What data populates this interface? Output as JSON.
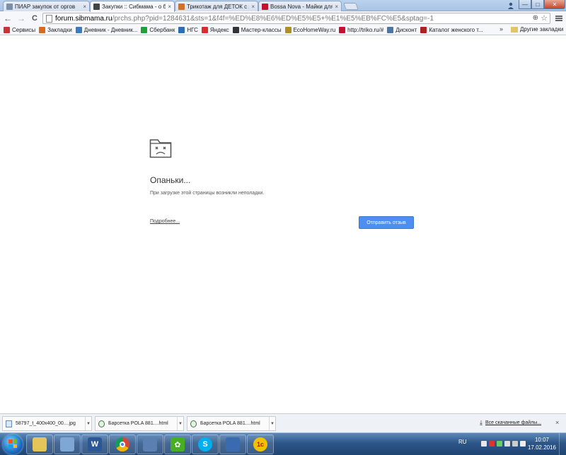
{
  "tabs": [
    {
      "title": "ПИАР закупок от оргов",
      "favicon_color": "#7a8fa8",
      "active": false
    },
    {
      "title": "Закупки :: Сибмама - о б",
      "favicon_color": "#444444",
      "active": true
    },
    {
      "title": "Трикотаж для ДЕТОК с яр",
      "favicon_color": "#c9732d",
      "active": false
    },
    {
      "title": "Bossa Nova - Майки для",
      "favicon_color": "#c8102e",
      "active": false
    }
  ],
  "tab_close_glyph": "×",
  "window_controls": {
    "minimize": "—",
    "maximize": "□",
    "close": "✕"
  },
  "toolbar": {
    "back": "←",
    "forward": "→",
    "reload": "C",
    "url_host": "forum.sibmama.ru",
    "url_path": "/prchs.php?pid=1284631&sts=1&f4f=%ED%E8%E6%ED%E5%E5+%E1%E5%EB%FC%E5&sptag=-1",
    "zoom_glyph": "⊕",
    "star_glyph": "☆"
  },
  "bookmarks": [
    {
      "label": "Сервисы",
      "icon": "grid-icon",
      "color": "#cc3333"
    },
    {
      "label": "Закладки",
      "icon": "pumpkin-icon",
      "color": "#d66b1f"
    },
    {
      "label": "Дневник - Дневник...",
      "icon": "diary-icon",
      "color": "#3b7bbf"
    },
    {
      "label": "Сбербанк",
      "icon": "sberbank-icon",
      "color": "#21a038"
    },
    {
      "label": "НГС",
      "icon": "ngs-icon",
      "color": "#2c6fb5"
    },
    {
      "label": "Яндекс",
      "icon": "yandex-icon",
      "color": "#e02b2b"
    },
    {
      "label": "Мастер-классы",
      "icon": "master-icon",
      "color": "#333333"
    },
    {
      "label": "EcoHomeWay.ru",
      "icon": "eco-icon",
      "color": "#b09020"
    },
    {
      "label": "http://triko.ru/#",
      "icon": "bn-icon",
      "color": "#c8102e"
    },
    {
      "label": "Дисконт",
      "icon": "vk-icon",
      "color": "#4a76a8"
    },
    {
      "label": "Каталог женского т...",
      "icon": "catalog-icon",
      "color": "#b02020"
    }
  ],
  "bookmarks_overflow": "»",
  "bookmarks_other": "Другие закладки",
  "error": {
    "title": "Опаньки...",
    "message": "При загрузке этой страницы возникли неполадки.",
    "more_link": "Подробнее...",
    "feedback_button": "Отправить отзыв"
  },
  "downloads": [
    {
      "name": "58797_t_400x400_00....jpg"
    },
    {
      "name": "Барсетка POLA 881....html"
    },
    {
      "name": "Барсетка POLA 881....html"
    }
  ],
  "downloads_show_all": "Все скачанные файлы...",
  "downloads_close": "×",
  "taskbar_apps": [
    {
      "name": "file-manager-icon",
      "color": "#e5c45a",
      "glyph": ""
    },
    {
      "name": "folder-icon",
      "color": "#7fa7d6",
      "glyph": ""
    },
    {
      "name": "word-icon",
      "color": "#2b5797",
      "glyph": "W"
    },
    {
      "name": "chrome-icon",
      "color": "#db4437",
      "glyph": ""
    },
    {
      "name": "network-icon",
      "color": "#5a7fb0",
      "glyph": ""
    },
    {
      "name": "icq-icon",
      "color": "#46b020",
      "glyph": "✿"
    },
    {
      "name": "skype-icon",
      "color": "#00aff0",
      "glyph": "S"
    },
    {
      "name": "photo-icon",
      "color": "#3a6ab0",
      "glyph": ""
    },
    {
      "name": "1c-icon",
      "color": "#f2c200",
      "glyph": "1c"
    }
  ],
  "tray": {
    "lang": "RU",
    "time": "10:07",
    "date": "17.02.2016"
  }
}
